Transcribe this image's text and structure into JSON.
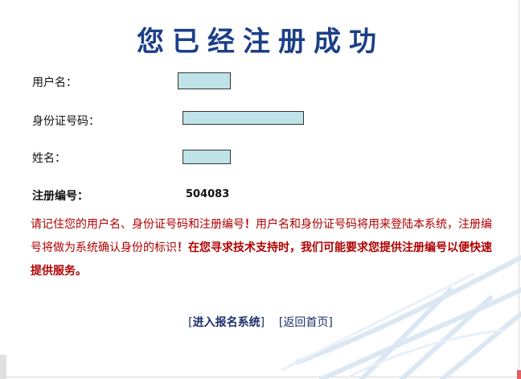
{
  "title": "您已经注册成功",
  "fields": {
    "username_label": "用户名：",
    "idcard_label": "身份证号码：",
    "name_label": "姓名：",
    "regno_label": "注册编号：",
    "regno_value": "504083"
  },
  "notice": {
    "part1": "请记住您的用户名、身份证号码和注册编号",
    "bang1": "！",
    "part2": "用户名和身份证号码将用来登陆本系统，注册编号将做为系统确认身份的标识",
    "bang2": "！",
    "part3_bold": "在您寻求技术支持时，我们可能要求您提供注册编号以便快速提供服务。"
  },
  "links": {
    "enter_open": "[",
    "enter_label": "进入报名系统",
    "enter_close": "]",
    "home_open": "[",
    "home_label": "返回首页",
    "home_close": "]"
  },
  "colors": {
    "title": "#1c3f88",
    "notice": "#b00000",
    "masked_fill": "#bfe3e8"
  }
}
